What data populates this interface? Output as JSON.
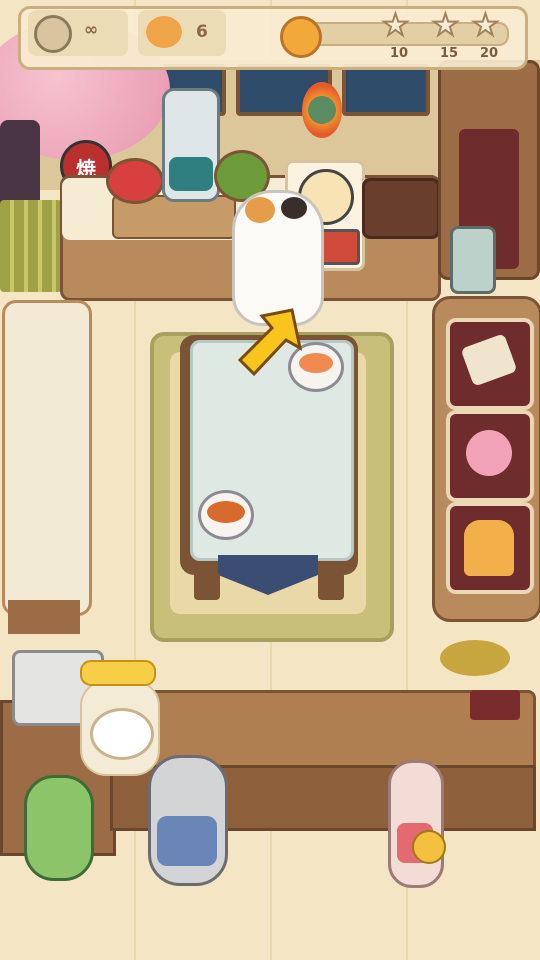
{
  "hud": {
    "timer_value": "∞",
    "customers_value": "6",
    "progress_fraction": 0.05,
    "stars": [
      {
        "label": "10"
      },
      {
        "label": "15"
      },
      {
        "label": "20"
      }
    ]
  },
  "lantern_text": "焼",
  "icons": {
    "timer": "clock-icon",
    "customer": "shiba-dog-icon",
    "coin": "paw-coin-icon",
    "star": "star-icon",
    "arrow": "pointer-arrow-icon"
  },
  "colors": {
    "accent_yellow": "#f7c51b",
    "wood": "#b98a5c",
    "shelf_slot": "#6f2c2c"
  }
}
